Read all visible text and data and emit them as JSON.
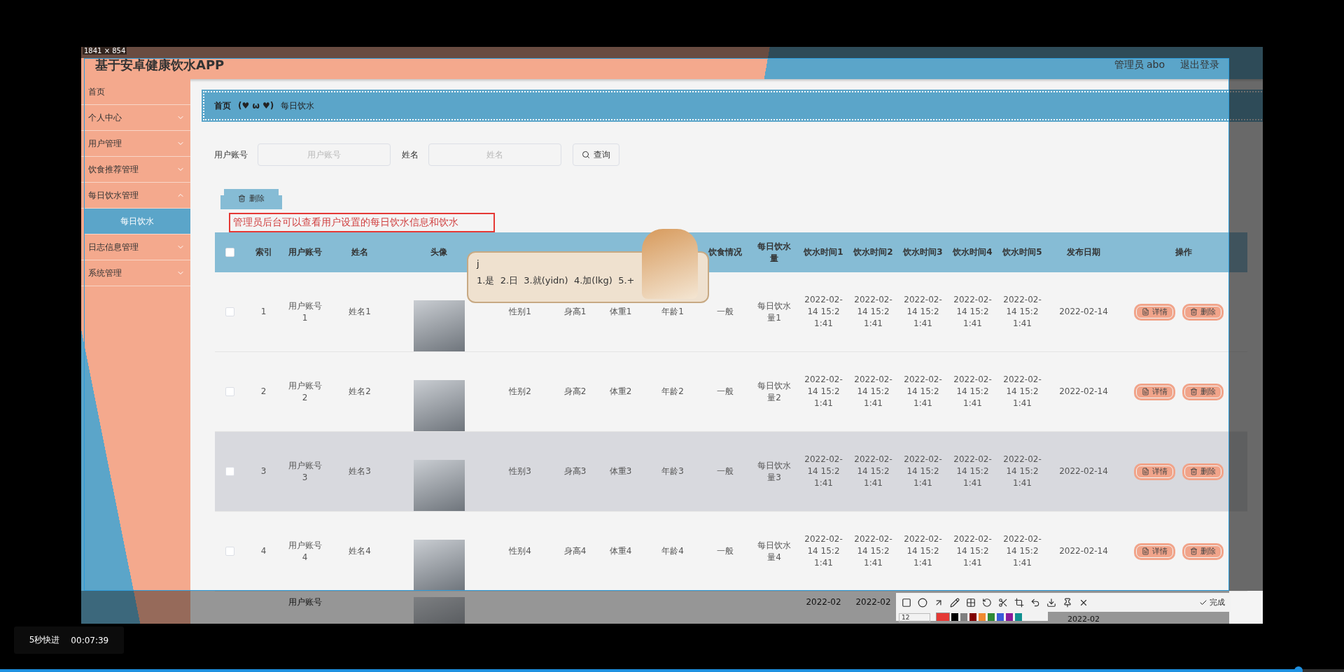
{
  "capture": {
    "size_label": "1841 × 854"
  },
  "app": {
    "title": "基于安卓健康饮水APP",
    "user": "管理员 abo",
    "logout": "退出登录"
  },
  "sidebar": {
    "items": [
      {
        "label": "首页",
        "expandable": false,
        "expanded": false
      },
      {
        "label": "个人中心",
        "expandable": true,
        "expanded": false
      },
      {
        "label": "用户管理",
        "expandable": true,
        "expanded": false
      },
      {
        "label": "饮食推荐管理",
        "expandable": true,
        "expanded": false
      },
      {
        "label": "每日饮水管理",
        "expandable": true,
        "expanded": true,
        "children": [
          {
            "label": "每日饮水",
            "selected": true
          }
        ]
      },
      {
        "label": "日志信息管理",
        "expandable": true,
        "expanded": false
      },
      {
        "label": "系统管理",
        "expandable": true,
        "expanded": false
      }
    ]
  },
  "breadcrumb": {
    "home": "首页",
    "separator": "(♥ ω ♥)",
    "current": "每日饮水"
  },
  "search": {
    "fields": [
      {
        "label": "用户账号",
        "placeholder": "用户账号"
      },
      {
        "label": "姓名",
        "placeholder": "姓名"
      }
    ],
    "button": "查询"
  },
  "delete_button": "删除",
  "annotation": "管理员后台可以查看用户设置的每日饮水信息和饮水",
  "table": {
    "select_all": {
      "checked": false
    },
    "columns": [
      "索引",
      "用户账号",
      "姓名",
      "头像",
      null,
      null,
      null,
      null,
      "饮食情况",
      "每日饮水量",
      "饮水时间1",
      "饮水时间2",
      "饮水时间3",
      "饮水时间4",
      "饮水时间5",
      "发布日期",
      "操作"
    ],
    "rows": [
      {
        "kind": "full",
        "checked": false,
        "highlighted": false,
        "index": "1",
        "account": "用户账号1",
        "name": "姓名1",
        "gender": "性别1",
        "height": "身高1",
        "weight": "体重1",
        "age": "年龄1",
        "diet": "一般",
        "water": "每日饮水量1",
        "times": [
          "2022-02-14 15:21:41",
          "2022-02-14 15:21:41",
          "2022-02-14 15:21:41",
          "2022-02-14 15:21:41",
          "2022-02-14 15:21:41"
        ],
        "date": "2022-02-14",
        "actions": [
          "详情",
          "删除"
        ]
      },
      {
        "kind": "full",
        "checked": false,
        "highlighted": false,
        "index": "2",
        "account": "用户账号2",
        "name": "姓名2",
        "gender": "性别2",
        "height": "身高2",
        "weight": "体重2",
        "age": "年龄2",
        "diet": "一般",
        "water": "每日饮水量2",
        "times": [
          "2022-02-14 15:21:41",
          "2022-02-14 15:21:41",
          "2022-02-14 15:21:41",
          "2022-02-14 15:21:41",
          "2022-02-14 15:21:41"
        ],
        "date": "2022-02-14",
        "actions": [
          "详情",
          "删除"
        ]
      },
      {
        "kind": "full",
        "checked": false,
        "highlighted": true,
        "index": "3",
        "account": "用户账号3",
        "name": "姓名3",
        "gender": "性别3",
        "height": "身高3",
        "weight": "体重3",
        "age": "年龄3",
        "diet": "一般",
        "water": "每日饮水量3",
        "times": [
          "2022-02-14 15:21:41",
          "2022-02-14 15:21:41",
          "2022-02-14 15:21:41",
          "2022-02-14 15:21:41",
          "2022-02-14 15:21:41"
        ],
        "date": "2022-02-14",
        "actions": [
          "详情",
          "删除"
        ]
      },
      {
        "kind": "full",
        "checked": false,
        "highlighted": false,
        "index": "4",
        "account": "用户账号4",
        "name": "姓名4",
        "gender": "性别4",
        "height": "身高4",
        "weight": "体重4",
        "age": "年龄4",
        "diet": "一般",
        "water": "每日饮水量4",
        "times": [
          "2022-02-14 15:21:41",
          "2022-02-14 15:21:41",
          "2022-02-14 15:21:41",
          "2022-02-14 15:21:41",
          "2022-02-14 15:21:41"
        ],
        "date": "2022-02-14",
        "actions": [
          "详情",
          "删除"
        ]
      },
      {
        "kind": "partial",
        "account": "用户账号",
        "times": [
          "2022-02",
          "2022-02"
        ],
        "date": "2022-02"
      }
    ]
  },
  "ime": {
    "composition": "j",
    "candidates": "1.是  2.日  3.就(yidn)  4.加(lkg)  5.+"
  },
  "snip_toolbar": {
    "done": "完成",
    "font_size": "12",
    "colors": [
      {
        "color": "#e53935",
        "selected": true
      },
      {
        "color": "#000000",
        "selected": false
      },
      {
        "color": "#808080",
        "selected": false
      },
      {
        "color": "#800000",
        "selected": false
      },
      {
        "color": "#f08a30",
        "selected": false
      },
      {
        "color": "#2e8b37",
        "selected": false
      },
      {
        "color": "#3a5bd9",
        "selected": false
      },
      {
        "color": "#8b1a9b",
        "selected": false
      },
      {
        "color": "#109090",
        "selected": false
      }
    ]
  },
  "player": {
    "seek_label": "5秒快进",
    "time": "00:07:39",
    "progress": {
      "level": 0.966
    }
  }
}
